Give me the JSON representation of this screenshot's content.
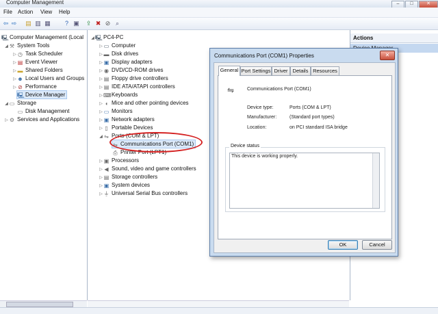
{
  "window": {
    "title": "Computer Management"
  },
  "menu": [
    "File",
    "Action",
    "View",
    "Help"
  ],
  "left_tree": {
    "root": "Computer Management (Local",
    "items": [
      {
        "label": "System Tools",
        "icon": "tools-icon"
      },
      {
        "label": "Task Scheduler",
        "icon": "clock-icon"
      },
      {
        "label": "Event Viewer",
        "icon": "event-viewer-icon"
      },
      {
        "label": "Shared Folders",
        "icon": "folder-icon"
      },
      {
        "label": "Local Users and Groups",
        "icon": "users-icon"
      },
      {
        "label": "Performance",
        "icon": "performance-icon"
      },
      {
        "label": "Device Manager",
        "icon": "device-manager-icon"
      },
      {
        "label": "Storage",
        "icon": "storage-icon"
      },
      {
        "label": "Disk Management",
        "icon": "disk-icon"
      },
      {
        "label": "Services and Applications",
        "icon": "services-icon"
      }
    ]
  },
  "device_tree": {
    "root": "PC4-PC",
    "items": [
      {
        "label": "Computer"
      },
      {
        "label": "Disk drives"
      },
      {
        "label": "Display adapters"
      },
      {
        "label": "DVD/CD-ROM drives"
      },
      {
        "label": "Floppy drive controllers"
      },
      {
        "label": "IDE ATA/ATAPI controllers"
      },
      {
        "label": "Keyboards"
      },
      {
        "label": "Mice and other pointing devices"
      },
      {
        "label": "Monitors"
      },
      {
        "label": "Network adapters"
      },
      {
        "label": "Portable Devices"
      },
      {
        "label": "Ports (COM & LPT)"
      },
      {
        "label": "Communications Port (COM1)"
      },
      {
        "label": "Printer Port (LPT1)"
      },
      {
        "label": "Processors"
      },
      {
        "label": "Sound, video and game controllers"
      },
      {
        "label": "Storage controllers"
      },
      {
        "label": "System devices"
      },
      {
        "label": "Universal Serial Bus controllers"
      }
    ]
  },
  "actions": {
    "header": "Actions",
    "subheader": "Device Manager"
  },
  "dialog": {
    "title": "Communications Port (COM1) Properties",
    "close": "✕",
    "tabs": [
      "General",
      "Port Settings",
      "Driver",
      "Details",
      "Resources"
    ],
    "device_name": "Communications Port (COM1)",
    "fields": [
      {
        "label": "Device type:",
        "value": "Ports (COM & LPT)"
      },
      {
        "label": "Manufacturer:",
        "value": "(Standard port types)"
      },
      {
        "label": "Location:",
        "value": "on PCI standard ISA bridge"
      }
    ],
    "status_label": "Device status",
    "status_text": "This device is working properly.",
    "ok": "OK",
    "cancel": "Cancel"
  },
  "colors": {
    "annotation": "#d42020",
    "selection": "#dbe9f9",
    "dialog_frame": "#c9dbef"
  }
}
